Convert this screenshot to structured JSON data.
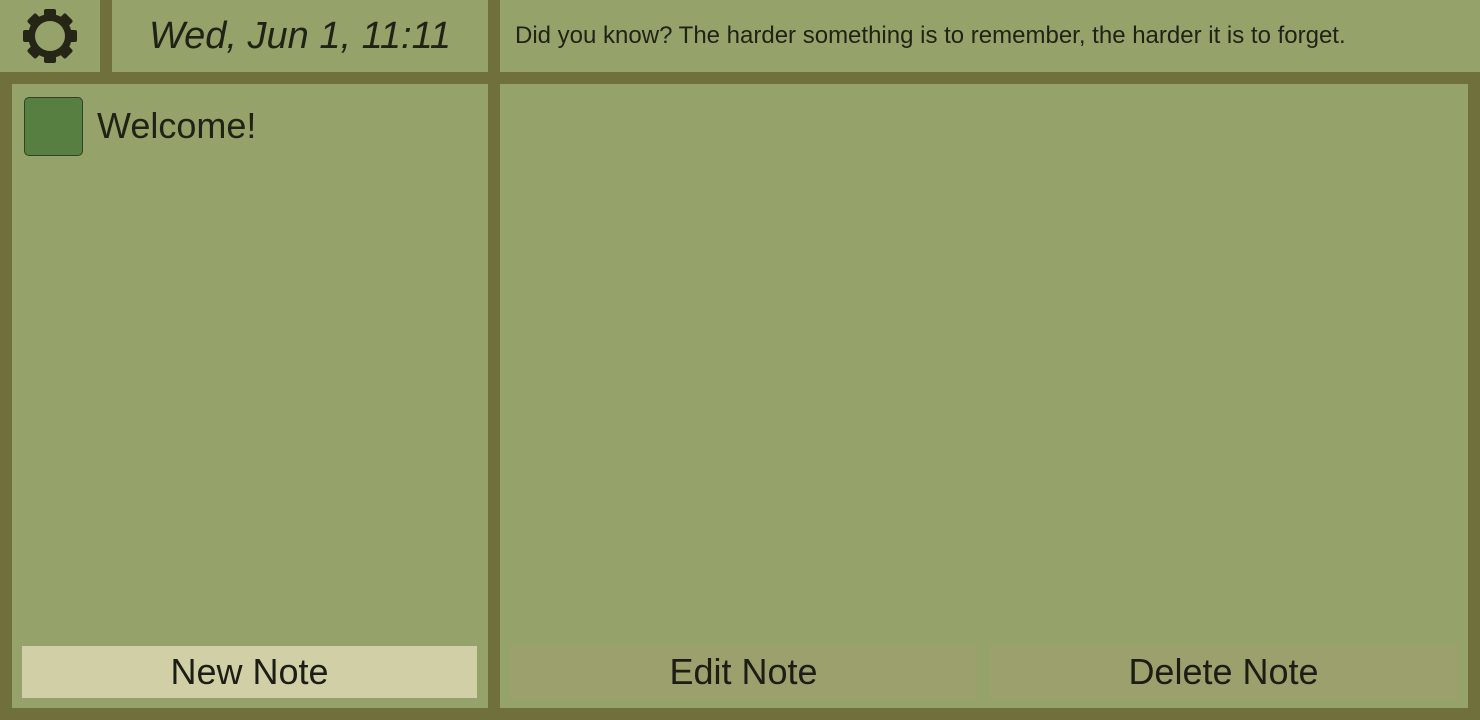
{
  "header": {
    "settings_icon": "gear-icon",
    "clock": "Wed, Jun 1, 11:11",
    "tip": "Did you know? The harder something is to remember, the harder it is to forget."
  },
  "notes": {
    "items": [
      {
        "title": "Welcome!",
        "color": "#577f42"
      }
    ],
    "new_label": "New Note"
  },
  "content": {
    "edit_label": "Edit Note",
    "delete_label": "Delete Note"
  },
  "colors": {
    "frame": "#6f703c",
    "panel": "#95a26a",
    "primary_button": "#d0cfa5",
    "secondary_button": "#9ba06d"
  }
}
